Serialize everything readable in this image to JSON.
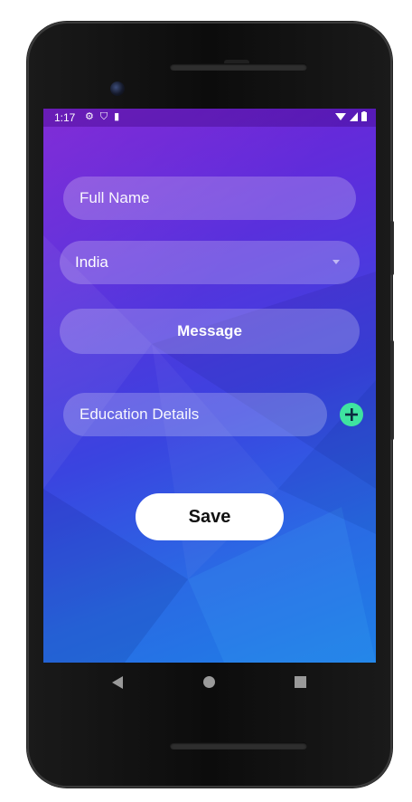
{
  "status_bar": {
    "time": "1:17",
    "left_icons": [
      "gear-icon",
      "shield-icon",
      "sd-card-icon"
    ],
    "right_icons": [
      "wifi-icon",
      "signal-icon",
      "battery-icon"
    ]
  },
  "form": {
    "full_name_placeholder": "Full Name",
    "country_value": "India",
    "message_label": "Message",
    "education_placeholder": "Education Details",
    "save_label": "Save"
  },
  "nav": {
    "back": "back-icon",
    "home": "home-icon",
    "recent": "recent-apps-icon"
  },
  "colors": {
    "accent_add": "#3fe3a0",
    "gradient_top": "#7a1fd4",
    "gradient_bottom": "#1e7fe6"
  }
}
